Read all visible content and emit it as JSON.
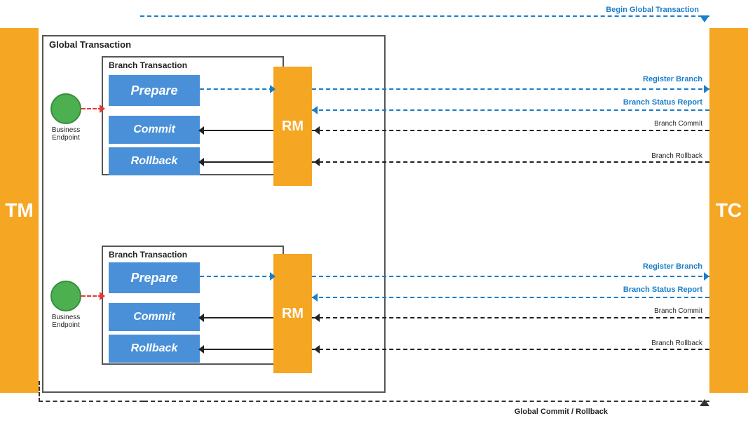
{
  "labels": {
    "tm": "TM",
    "tc": "TC",
    "rm": "RM",
    "global_transaction": "Global Transaction",
    "branch_transaction": "Branch Transaction",
    "prepare": "Prepare",
    "commit": "Commit",
    "rollback": "Rollback",
    "business_endpoint": "Business\nEndpoint",
    "begin_global_transaction": "Begin Global Transaction",
    "register_branch": "Register Branch",
    "branch_status_report": "Branch Status Report",
    "branch_commit": "Branch Commit",
    "branch_rollback": "Branch Rollback",
    "global_commit_rollback": "Global Commit / Rollback"
  },
  "colors": {
    "orange": "#F5A623",
    "blue_box": "#4A90D9",
    "blue_arrow": "#1a7ec8",
    "green_circle": "#4CAF50",
    "red_arrow": "#e53935",
    "dark": "#333",
    "white": "#ffffff"
  }
}
